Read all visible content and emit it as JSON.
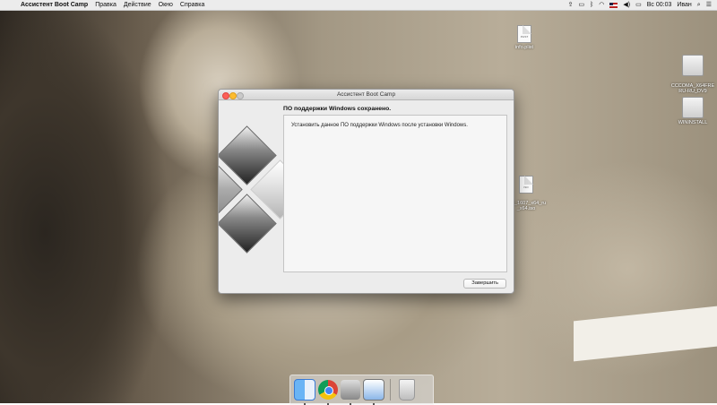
{
  "menubar": {
    "app_name": "Ассистент Boot Camp",
    "items": [
      "Правка",
      "Действие",
      "Окно",
      "Справка"
    ],
    "clock": "Вс 00:03",
    "user": "Иван"
  },
  "desktop_icons": [
    {
      "label": "info.plist",
      "type": "file",
      "filetype": "PLIST"
    },
    {
      "label": "CCCOMA_X64FRE\nRU-RU_DV9",
      "type": "drive"
    },
    {
      "label": "WININSTALL",
      "type": "drive"
    },
    {
      "label": "_10_1607_x64_ru\n_x64.iso",
      "type": "file",
      "filetype": "ISO"
    }
  ],
  "window": {
    "title": "Ассистент Boot Camp",
    "heading": "ПО поддержки Windows сохранено.",
    "body": "Установить данное ПО поддержки Windows после установки Windows.",
    "finish_label": "Завершить"
  },
  "dock": {
    "apps": [
      "finder-icon",
      "chrome-icon",
      "bootcamp-icon",
      "preview-icon",
      "trash-icon"
    ]
  }
}
